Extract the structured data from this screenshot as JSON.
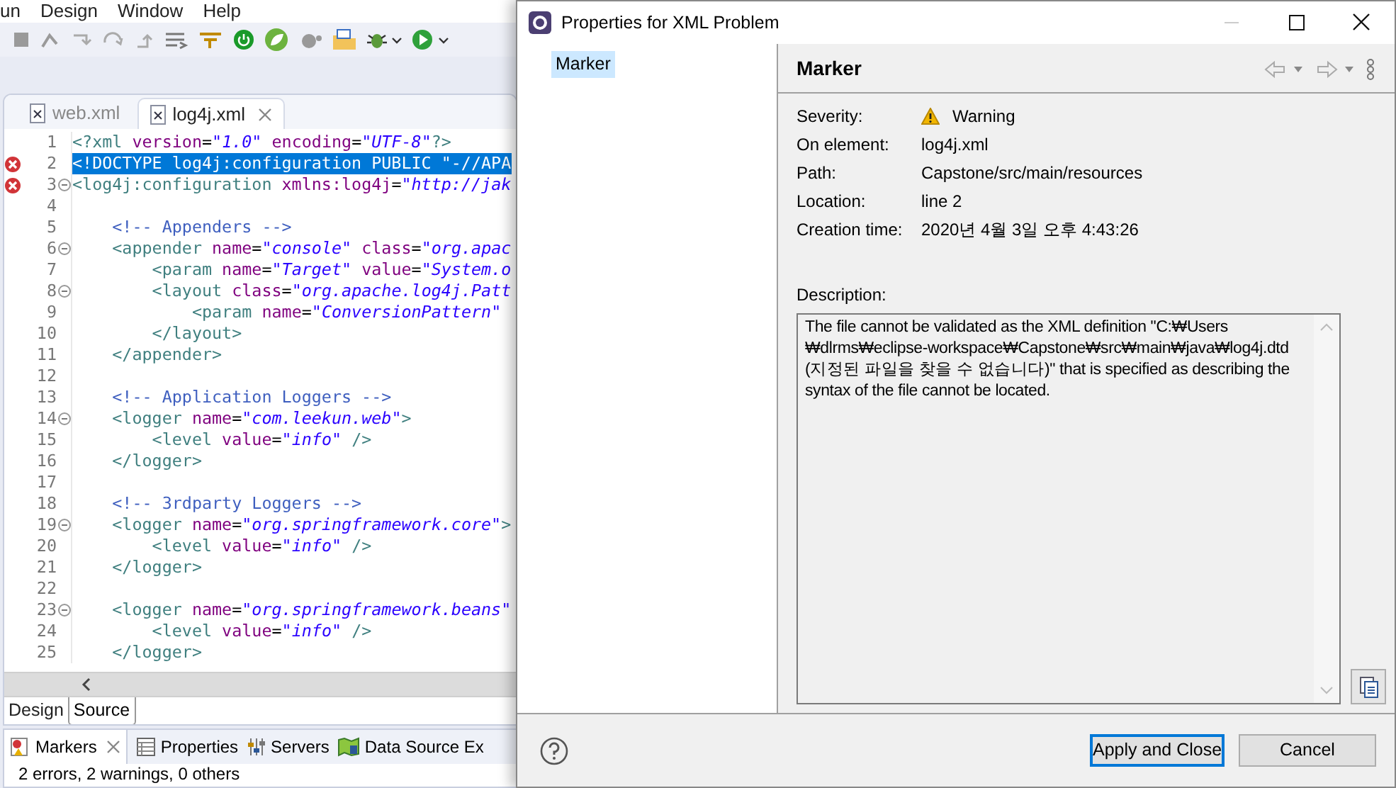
{
  "menu": [
    "un",
    "Design",
    "Window",
    "Help"
  ],
  "editor_tabs": [
    {
      "label": "web.xml",
      "selected": false
    },
    {
      "label": "log4j.xml",
      "selected": true
    }
  ],
  "code_lines": [
    {
      "number": "1",
      "error": false,
      "fold": false,
      "selected": false,
      "segments": [
        {
          "kind": "tag",
          "text": "<?xml"
        },
        {
          "kind": "attr",
          "text": " version"
        },
        {
          "kind": "plain",
          "text": "="
        },
        {
          "kind": "value",
          "text": "\"1.0\""
        },
        {
          "kind": "attr",
          "text": " encoding"
        },
        {
          "kind": "plain",
          "text": "="
        },
        {
          "kind": "value",
          "text": "\"UTF-8\""
        },
        {
          "kind": "tag",
          "text": "?>"
        }
      ]
    },
    {
      "number": "2",
      "error": true,
      "fold": false,
      "selected": true,
      "segments": [
        {
          "kind": "plain",
          "text": "<!DOCTYPE log4j:configuration PUBLIC \"-//APA"
        }
      ]
    },
    {
      "number": "3",
      "error": true,
      "fold": true,
      "selected": false,
      "segments": [
        {
          "kind": "tag",
          "text": "<log4j:configuration"
        },
        {
          "kind": "attr",
          "text": " xmlns:log4j"
        },
        {
          "kind": "plain",
          "text": "="
        },
        {
          "kind": "value",
          "text": "\"http://jak"
        }
      ]
    },
    {
      "number": "4",
      "error": false,
      "fold": false,
      "selected": false
    },
    {
      "number": "5",
      "error": false,
      "fold": false,
      "selected": false,
      "segments": [
        {
          "kind": "comment",
          "text": "    <!-- Appenders -->"
        }
      ]
    },
    {
      "number": "6",
      "error": false,
      "fold": true,
      "selected": false,
      "segments": [
        {
          "kind": "tag",
          "text": "    <appender"
        },
        {
          "kind": "attr",
          "text": " name"
        },
        {
          "kind": "plain",
          "text": "="
        },
        {
          "kind": "value",
          "text": "\"console\""
        },
        {
          "kind": "attr",
          "text": " class"
        },
        {
          "kind": "plain",
          "text": "="
        },
        {
          "kind": "value",
          "text": "\"org.apac"
        }
      ]
    },
    {
      "number": "7",
      "error": false,
      "fold": false,
      "selected": false,
      "segments": [
        {
          "kind": "tag",
          "text": "        <param"
        },
        {
          "kind": "attr",
          "text": " name"
        },
        {
          "kind": "plain",
          "text": "="
        },
        {
          "kind": "value",
          "text": "\"Target\""
        },
        {
          "kind": "attr",
          "text": " value"
        },
        {
          "kind": "plain",
          "text": "="
        },
        {
          "kind": "value",
          "text": "\"System.o"
        }
      ]
    },
    {
      "number": "8",
      "error": false,
      "fold": true,
      "selected": false,
      "segments": [
        {
          "kind": "tag",
          "text": "        <layout"
        },
        {
          "kind": "attr",
          "text": " class"
        },
        {
          "kind": "plain",
          "text": "="
        },
        {
          "kind": "value",
          "text": "\"org.apache.log4j.Patt"
        }
      ]
    },
    {
      "number": "9",
      "error": false,
      "fold": false,
      "selected": false,
      "segments": [
        {
          "kind": "tag",
          "text": "            <param"
        },
        {
          "kind": "attr",
          "text": " name"
        },
        {
          "kind": "plain",
          "text": "="
        },
        {
          "kind": "value",
          "text": "\"ConversionPattern\""
        }
      ]
    },
    {
      "number": "10",
      "error": false,
      "fold": false,
      "selected": false,
      "segments": [
        {
          "kind": "tag",
          "text": "        </layout>"
        }
      ]
    },
    {
      "number": "11",
      "error": false,
      "fold": false,
      "selected": false,
      "segments": [
        {
          "kind": "tag",
          "text": "    </appender>"
        }
      ]
    },
    {
      "number": "12",
      "error": false,
      "fold": false,
      "selected": false
    },
    {
      "number": "13",
      "error": false,
      "fold": false,
      "selected": false,
      "segments": [
        {
          "kind": "comment",
          "text": "    <!-- Application Loggers -->"
        }
      ]
    },
    {
      "number": "14",
      "error": false,
      "fold": true,
      "selected": false,
      "segments": [
        {
          "kind": "tag",
          "text": "    <logger"
        },
        {
          "kind": "attr",
          "text": " name"
        },
        {
          "kind": "plain",
          "text": "="
        },
        {
          "kind": "value",
          "text": "\"com.leekun.web\""
        },
        {
          "kind": "tag",
          "text": ">"
        }
      ]
    },
    {
      "number": "15",
      "error": false,
      "fold": false,
      "selected": false,
      "segments": [
        {
          "kind": "tag",
          "text": "        <level"
        },
        {
          "kind": "attr",
          "text": " value"
        },
        {
          "kind": "plain",
          "text": "="
        },
        {
          "kind": "value",
          "text": "\"info\""
        },
        {
          "kind": "tag",
          "text": " />"
        }
      ]
    },
    {
      "number": "16",
      "error": false,
      "fold": false,
      "selected": false,
      "segments": [
        {
          "kind": "tag",
          "text": "    </logger>"
        }
      ]
    },
    {
      "number": "17",
      "error": false,
      "fold": false,
      "selected": false
    },
    {
      "number": "18",
      "error": false,
      "fold": false,
      "selected": false,
      "segments": [
        {
          "kind": "comment",
          "text": "    <!-- 3rdparty Loggers -->"
        }
      ]
    },
    {
      "number": "19",
      "error": false,
      "fold": true,
      "selected": false,
      "segments": [
        {
          "kind": "tag",
          "text": "    <logger"
        },
        {
          "kind": "attr",
          "text": " name"
        },
        {
          "kind": "plain",
          "text": "="
        },
        {
          "kind": "value",
          "text": "\"org.springframework.core\""
        },
        {
          "kind": "tag",
          "text": ">"
        }
      ]
    },
    {
      "number": "20",
      "error": false,
      "fold": false,
      "selected": false,
      "segments": [
        {
          "kind": "tag",
          "text": "        <level"
        },
        {
          "kind": "attr",
          "text": " value"
        },
        {
          "kind": "plain",
          "text": "="
        },
        {
          "kind": "value",
          "text": "\"info\""
        },
        {
          "kind": "tag",
          "text": " />"
        }
      ]
    },
    {
      "number": "21",
      "error": false,
      "fold": false,
      "selected": false,
      "segments": [
        {
          "kind": "tag",
          "text": "    </logger>"
        }
      ]
    },
    {
      "number": "22",
      "error": false,
      "fold": false,
      "selected": false
    },
    {
      "number": "23",
      "error": false,
      "fold": true,
      "selected": false,
      "segments": [
        {
          "kind": "tag",
          "text": "    <logger"
        },
        {
          "kind": "attr",
          "text": " name"
        },
        {
          "kind": "plain",
          "text": "="
        },
        {
          "kind": "value",
          "text": "\"org.springframework.beans\""
        }
      ]
    },
    {
      "number": "24",
      "error": false,
      "fold": false,
      "selected": false,
      "segments": [
        {
          "kind": "tag",
          "text": "        <level"
        },
        {
          "kind": "attr",
          "text": " value"
        },
        {
          "kind": "plain",
          "text": "="
        },
        {
          "kind": "value",
          "text": "\"info\""
        },
        {
          "kind": "tag",
          "text": " />"
        }
      ]
    },
    {
      "number": "25",
      "error": false,
      "fold": false,
      "selected": false,
      "segments": [
        {
          "kind": "tag",
          "text": "    </logger>"
        }
      ]
    }
  ],
  "editor_mode_tabs": [
    {
      "label": "Design",
      "selected": false
    },
    {
      "label": "Source",
      "selected": true
    }
  ],
  "view_tabs": [
    {
      "label": "Markers",
      "selected": true
    },
    {
      "label": "Properties",
      "selected": false
    },
    {
      "label": "Servers",
      "selected": false
    },
    {
      "label": "Data Source Ex",
      "selected": false
    }
  ],
  "markers_summary": "2 errors, 2 warnings, 0 others",
  "dialog": {
    "title": "Properties for XML Problem",
    "nav_items": [
      {
        "label": "Marker",
        "selected": true
      }
    ],
    "page_title": "Marker",
    "properties": [
      {
        "label": "Severity:",
        "value": "Warning",
        "kind": "warning"
      },
      {
        "label": "On element:",
        "value": "log4j.xml",
        "kind": "text"
      },
      {
        "label": "Path:",
        "value": "Capstone/src/main/resources",
        "kind": "text"
      },
      {
        "label": "Location:",
        "value": "line 2",
        "kind": "text"
      },
      {
        "label": "Creation time:",
        "value": "2020년 4월 3일 오후 4:43:26",
        "kind": "text"
      }
    ],
    "description_label": "Description:",
    "description": "The file cannot be validated as the XML definition \"C:₩Users ₩dlrms₩eclipse-workspace₩Capstone₩src₩main₩java₩log4j.dtd (지정된 파일을 찾을 수 없습니다)\" that is specified as describing the syntax of the file cannot be located.",
    "buttons": [
      {
        "label": "Apply and Close",
        "default": true
      },
      {
        "label": "Cancel",
        "default": false
      }
    ]
  }
}
